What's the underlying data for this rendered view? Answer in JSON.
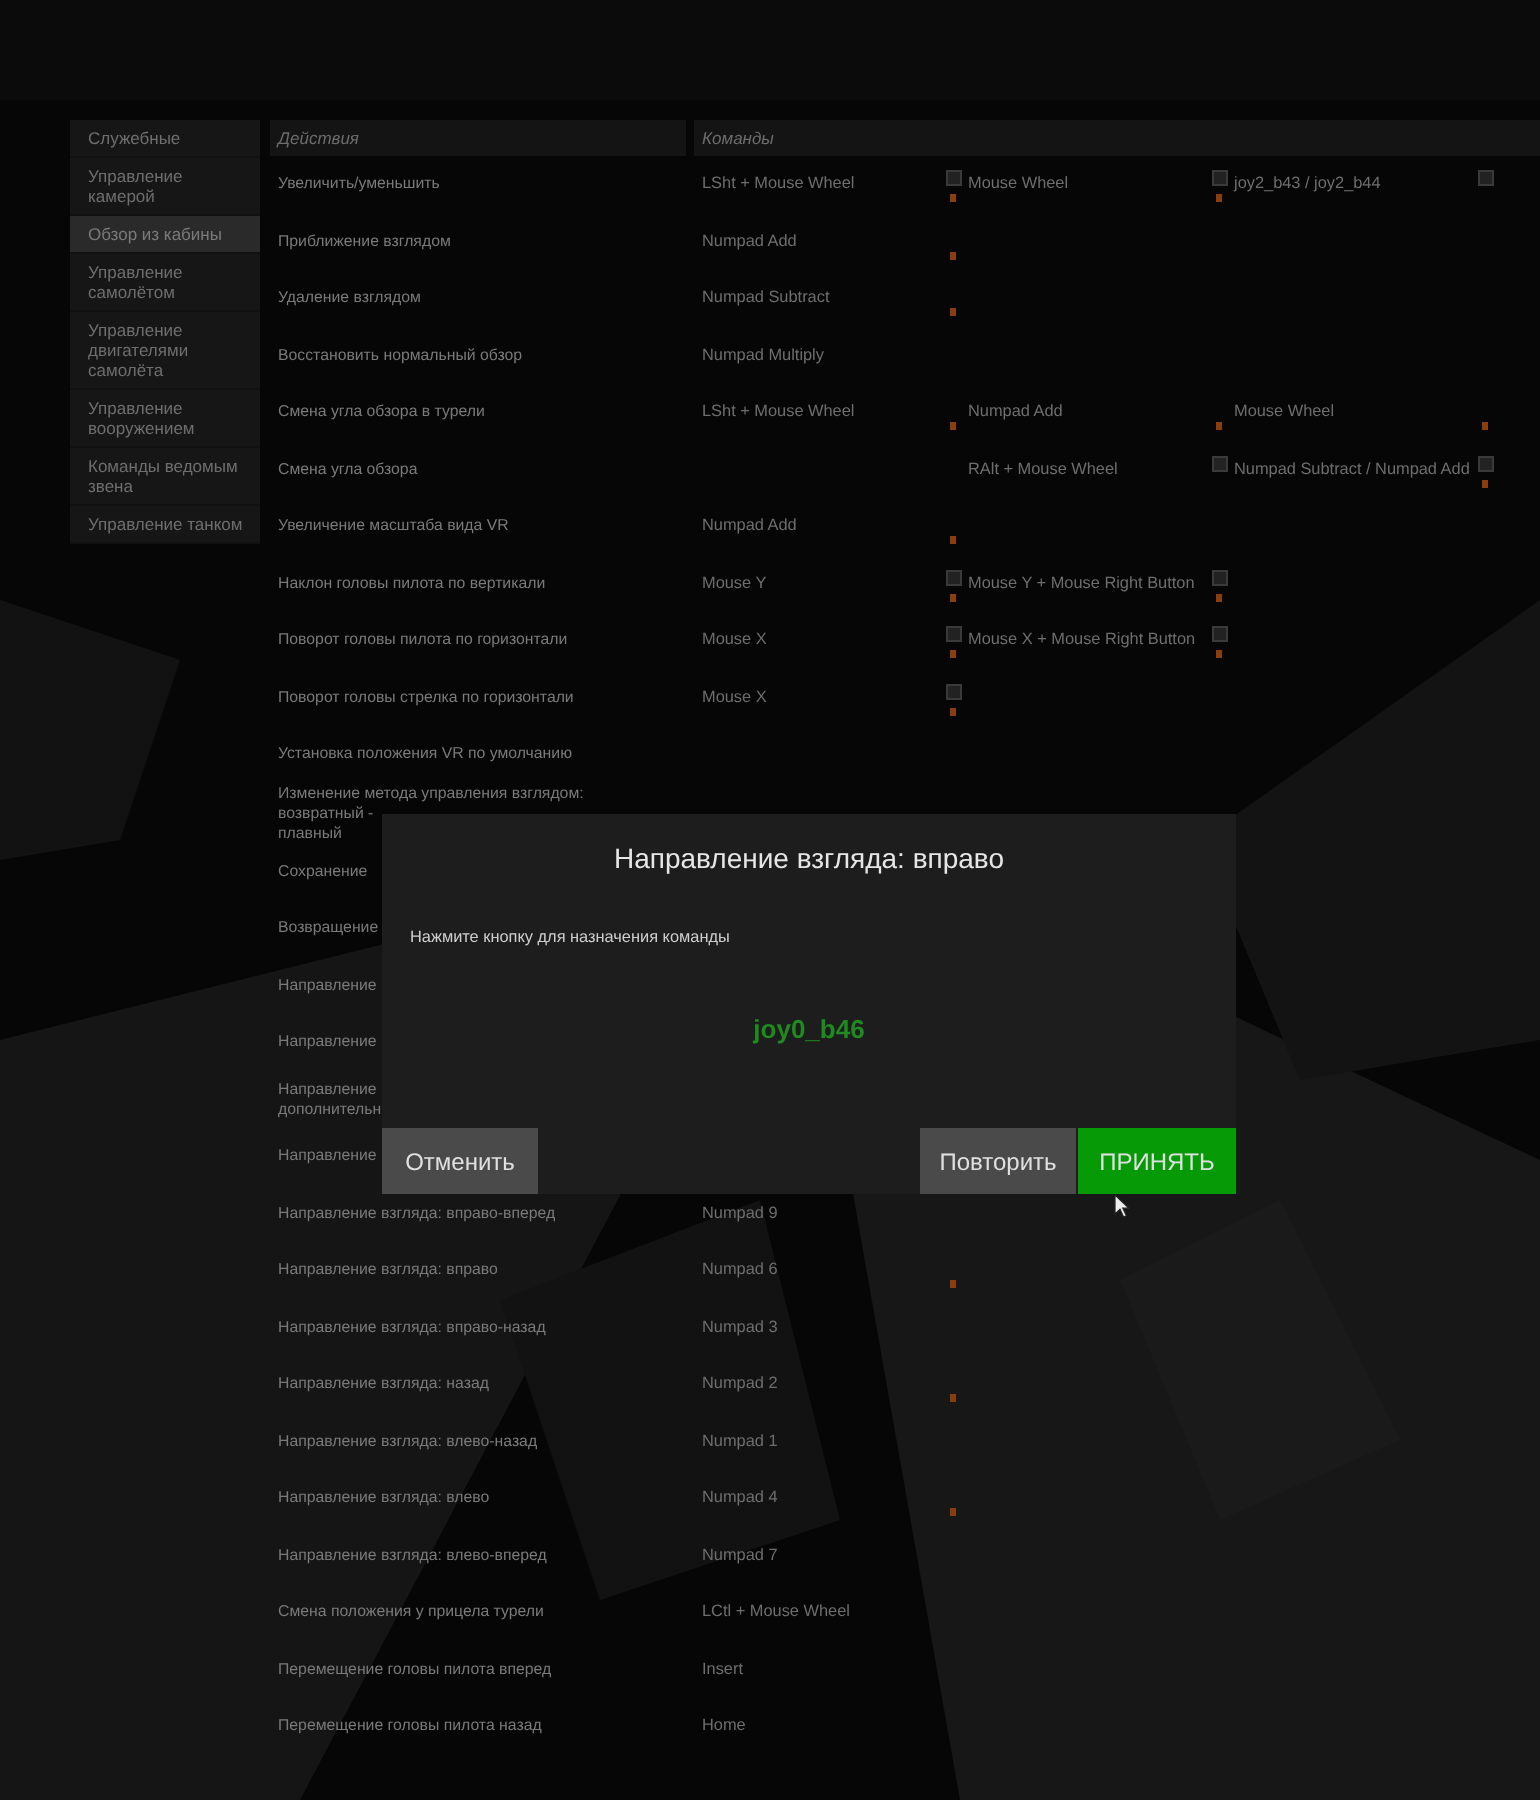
{
  "sidebar": {
    "items": [
      {
        "label": "Служебные",
        "selected": false
      },
      {
        "label": "Управление камерой",
        "selected": false
      },
      {
        "label": "Обзор из кабины",
        "selected": true
      },
      {
        "label": "Управление самолётом",
        "selected": false
      },
      {
        "label": "Управление двигателями самолёта",
        "selected": false
      },
      {
        "label": "Управление вооружением",
        "selected": false
      },
      {
        "label": "Команды ведомым звена",
        "selected": false
      },
      {
        "label": "Управление танком",
        "selected": false
      }
    ]
  },
  "table": {
    "columns": [
      "Действия",
      "Команды"
    ],
    "rows": [
      {
        "action": "Увеличить/уменьшить",
        "commands": [
          {
            "text": "LSht + Mouse Wheel",
            "reset": true,
            "marker": true
          },
          {
            "text": "Mouse Wheel",
            "reset": true,
            "marker": true
          },
          {
            "text": "joy2_b43 / joy2_b44",
            "reset": true,
            "marker": false
          }
        ]
      },
      {
        "action": "Приближение взглядом",
        "commands": [
          {
            "text": "Numpad Add",
            "reset": false,
            "marker": true
          }
        ]
      },
      {
        "action": "Удаление взглядом",
        "commands": [
          {
            "text": "Numpad Subtract",
            "reset": false,
            "marker": true
          }
        ]
      },
      {
        "action": "Восстановить нормальный обзор",
        "commands": [
          {
            "text": "Numpad Multiply",
            "reset": false,
            "marker": false
          }
        ]
      },
      {
        "action": "Смена угла обзора в турели",
        "commands": [
          {
            "text": "LSht + Mouse Wheel",
            "reset": false,
            "marker": true
          },
          {
            "text": "Numpad Add",
            "reset": false,
            "marker": true
          },
          {
            "text": "Mouse Wheel",
            "reset": false,
            "marker": true
          }
        ]
      },
      {
        "action": "Смена угла обзора",
        "first_column_empty": true,
        "commands": [
          {
            "text": "RAlt + Mouse Wheel",
            "reset": true,
            "marker": false
          },
          {
            "text": "Numpad Subtract / Numpad Add",
            "reset": true,
            "marker": true
          }
        ]
      },
      {
        "action": "Увеличение масштаба вида VR",
        "commands": [
          {
            "text": "Numpad Add",
            "reset": false,
            "marker": true
          }
        ]
      },
      {
        "action": "Наклон головы пилота по вертикали",
        "commands": [
          {
            "text": "Mouse Y",
            "reset": true,
            "marker": true
          },
          {
            "text": "Mouse Y + Mouse Right Button",
            "reset": true,
            "marker": true
          }
        ]
      },
      {
        "action": "Поворот головы пилота по горизонтали",
        "commands": [
          {
            "text": "Mouse X",
            "reset": true,
            "marker": true
          },
          {
            "text": "Mouse X + Mouse Right Button",
            "reset": true,
            "marker": true
          }
        ]
      },
      {
        "action": "Поворот головы стрелка по горизонтали",
        "commands": [
          {
            "text": "Mouse X",
            "reset": true,
            "marker": true
          }
        ]
      },
      {
        "action": "Установка положения VR по умолчанию",
        "commands": []
      },
      {
        "action": "Изменение метода управления взглядом:\nвозвратный -\nплавный",
        "commands": []
      },
      {
        "action": "Сохранение",
        "commands": []
      },
      {
        "action": "Возвращение",
        "commands": []
      },
      {
        "action": "Направление",
        "commands": []
      },
      {
        "action": "Направление",
        "commands": []
      },
      {
        "action": "Направление\nдополнительн",
        "commands": []
      },
      {
        "action": "Направление",
        "commands": []
      },
      {
        "action": "Направление взгляда: вправо-вперед",
        "commands": [
          {
            "text": "Numpad 9",
            "reset": false,
            "marker": false
          }
        ]
      },
      {
        "action": "Направление взгляда: вправо",
        "commands": [
          {
            "text": "Numpad 6",
            "reset": false,
            "marker": true
          }
        ]
      },
      {
        "action": "Направление взгляда: вправо-назад",
        "commands": [
          {
            "text": "Numpad 3",
            "reset": false,
            "marker": false
          }
        ]
      },
      {
        "action": "Направление взгляда: назад",
        "commands": [
          {
            "text": "Numpad 2",
            "reset": false,
            "marker": true
          }
        ]
      },
      {
        "action": "Направление взгляда: влево-назад",
        "commands": [
          {
            "text": "Numpad 1",
            "reset": false,
            "marker": false
          }
        ]
      },
      {
        "action": "Направление взгляда: влево",
        "commands": [
          {
            "text": "Numpad 4",
            "reset": false,
            "marker": true
          }
        ]
      },
      {
        "action": "Направление взгляда: влево-вперед",
        "commands": [
          {
            "text": "Numpad 7",
            "reset": false,
            "marker": false
          }
        ]
      },
      {
        "action": "Смена положения у прицела турели",
        "commands": [
          {
            "text": "LCtl + Mouse Wheel",
            "reset": false,
            "marker": false
          }
        ]
      },
      {
        "action": "Перемещение головы пилота вперед",
        "commands": [
          {
            "text": "Insert",
            "reset": false,
            "marker": false
          }
        ]
      },
      {
        "action": "Перемещение головы пилота назад",
        "commands": [
          {
            "text": "Home",
            "reset": false,
            "marker": false
          }
        ]
      }
    ]
  },
  "dialog": {
    "title": "Направление взгляда: вправо",
    "prompt": "Нажмите кнопку для назначения команды",
    "key": "joy0_b46",
    "buttons": [
      {
        "label": "Отменить",
        "kind": "secondary"
      },
      {
        "label": "Повторить",
        "kind": "secondary"
      },
      {
        "label": "ПРИНЯТЬ",
        "kind": "primary"
      }
    ]
  }
}
